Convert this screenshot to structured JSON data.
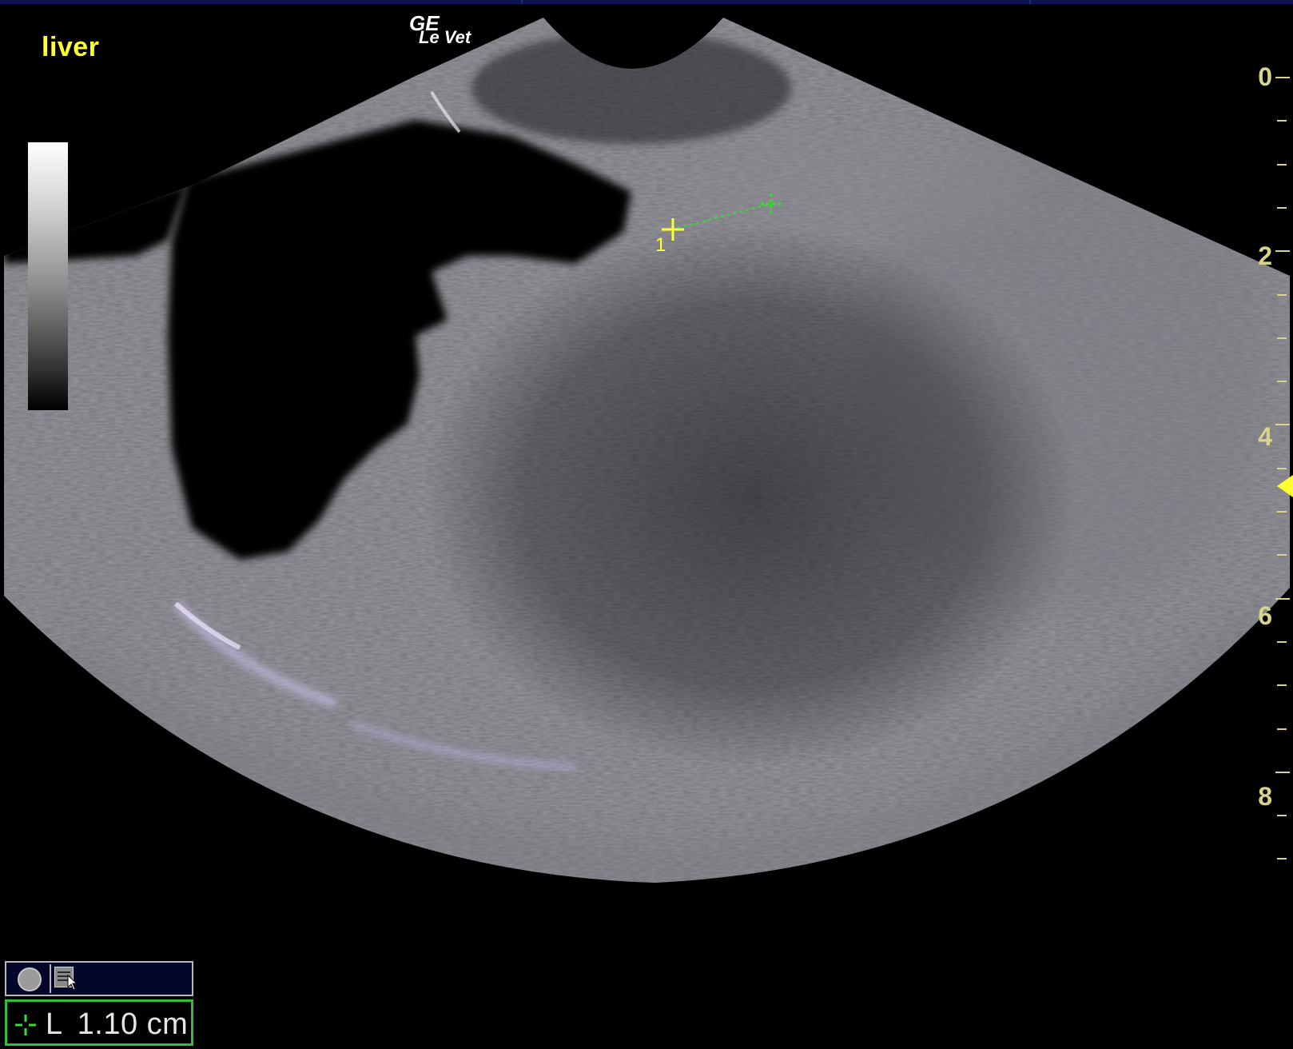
{
  "study": {
    "label": "liver",
    "label_color": "#ffff33"
  },
  "brand": {
    "line1": "GE",
    "line2": "Le Vet"
  },
  "depth_scale": {
    "color": "#d8d48a",
    "labels": [
      "0",
      "2",
      "4",
      "6",
      "8"
    ],
    "focus_marker_color": "#ffff33"
  },
  "caliper": {
    "start_number": "1",
    "start_color": "#ffff33",
    "end_color": "#33dd33"
  },
  "measurement": {
    "name": "L",
    "value": "1.10 cm",
    "color": "#33dd33"
  },
  "toolbar": {
    "record_icon": "circle-record-icon",
    "report_icon": "report-document-icon",
    "cursor_icon": "mouse-pointer-icon"
  }
}
